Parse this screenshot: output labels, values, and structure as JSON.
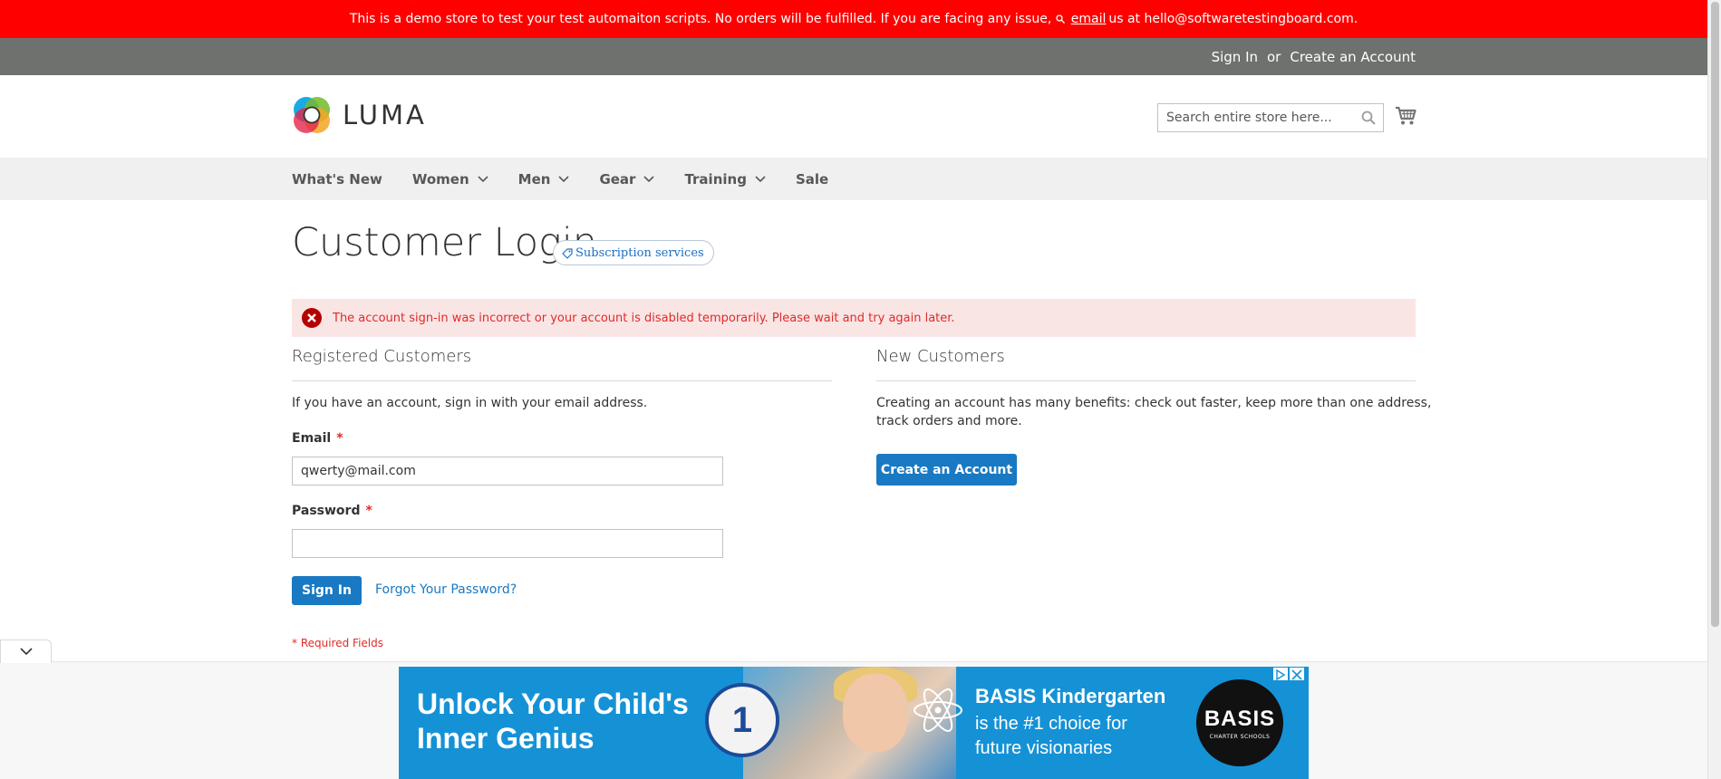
{
  "demo_banner": {
    "text_before": "This is a demo store to test your test automaiton scripts. No orders will be fulfilled. If you are facing any issue,",
    "email_link": "email",
    "text_after": "us at hello@softwaretestingboard.com."
  },
  "top_links": {
    "sign_in": "Sign In",
    "or": "or",
    "create_account": "Create an Account"
  },
  "header": {
    "logo_text": "LUMA",
    "search_placeholder": "Search entire store here..."
  },
  "nav": {
    "items": [
      {
        "label": "What's New",
        "has_dropdown": false
      },
      {
        "label": "Women",
        "has_dropdown": true
      },
      {
        "label": "Men",
        "has_dropdown": true
      },
      {
        "label": "Gear",
        "has_dropdown": true
      },
      {
        "label": "Training",
        "has_dropdown": true
      },
      {
        "label": "Sale",
        "has_dropdown": false
      }
    ]
  },
  "page": {
    "title": "Customer Login",
    "subscription_badge": "Subscription services"
  },
  "error": {
    "message": "The account sign-in was incorrect or your account is disabled temporarily. Please wait and try again later."
  },
  "registered": {
    "title": "Registered Customers",
    "intro": "If you have an account, sign in with your email address.",
    "email_label": "Email",
    "email_value": "qwerty@mail.com",
    "password_label": "Password",
    "password_value": "",
    "required_mark": "*",
    "sign_in_button": "Sign In",
    "forgot_link": "Forgot Your Password?",
    "required_note": "* Required Fields"
  },
  "new_customers": {
    "title": "New Customers",
    "intro_line1": "Creating an account has many benefits: check out faster, keep more than one address,",
    "intro_line2": "track orders and more.",
    "create_button": "Create an Account"
  },
  "ad": {
    "headline_line1": "Unlock Your Child's",
    "headline_line2": "Inner Genius",
    "badge_number": "1",
    "subhead_title": "BASIS Kindergarten",
    "subhead_line1": "is the #1 choice for",
    "subhead_line2": "future visionaries",
    "logo_main": "BASIS",
    "logo_sub": "CHARTER SCHOOLS"
  },
  "colors": {
    "banner_red": "#ff0000",
    "top_bar_gray": "#6e716e",
    "nav_bg": "#f0f0f0",
    "primary_blue": "#1979c3",
    "error_bg": "#fae5e5",
    "error_text": "#e02b27",
    "ad_blue": "#1592d6"
  },
  "icons": {
    "search": "search-icon",
    "cart": "cart-icon",
    "error": "error-circle-icon",
    "tag": "tag-icon",
    "chevron": "chevron-down-icon"
  }
}
